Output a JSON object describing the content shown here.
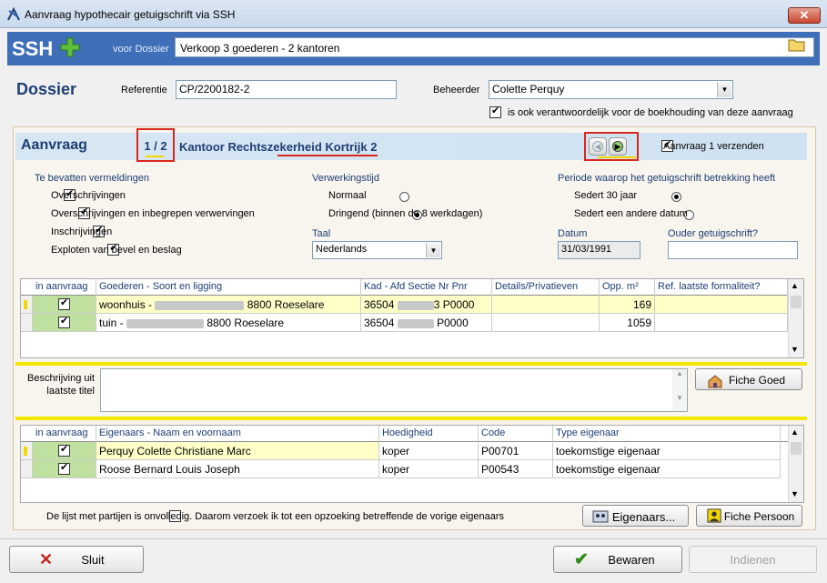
{
  "window": {
    "title": "Aanvraag hypothecair getuigschrift via SSH",
    "close_label": "✕"
  },
  "header": {
    "logo": "SSH",
    "voor_dossier_label": "voor Dossier",
    "dossier_value": "Verkoop  3 goederen - 2 kantoren"
  },
  "dossier": {
    "heading": "Dossier",
    "referentie_label": "Referentie",
    "referentie_value": "CP/2200182-2",
    "beheerder_label": "Beheerder",
    "beheerder_value": "Colette Perquy",
    "boekhouding_label": "is ook verantwoordelijk voor de boekhouding van deze aanvraag"
  },
  "aanvraag": {
    "heading": "Aanvraag",
    "counter": "1 / 2",
    "kantoor": "Kantoor Rechtszekerheid Kortrijk 2",
    "verzenden_label": "Aanvraag 1 verzenden"
  },
  "vermeldingen": {
    "title": "Te bevatten vermeldingen",
    "items": [
      {
        "label": "Overschrijvingen",
        "checked": true
      },
      {
        "label": "Overschrijvingen en inbegrepen verwervingen",
        "checked": true
      },
      {
        "label": "Inschrijvingen",
        "checked": true
      },
      {
        "label": "Exploten van bevel en beslag",
        "checked": true
      }
    ]
  },
  "verwerkingstijd": {
    "title": "Verwerkingstijd",
    "options": [
      {
        "label": "Normaal",
        "selected": false
      },
      {
        "label": "Dringend (binnen de 8 werkdagen)",
        "selected": true
      }
    ],
    "taal_label": "Taal",
    "taal_value": "Nederlands"
  },
  "periode": {
    "title": "Periode waarop het getuigschrift betrekking heeft",
    "options": [
      {
        "label": "Sedert 30 jaar",
        "selected": true
      },
      {
        "label": "Sedert een andere datum",
        "selected": false
      }
    ],
    "datum_label": "Datum",
    "datum_value": "31/03/1991",
    "ouder_label": "Ouder getuigschrift?"
  },
  "goederen": {
    "headers": [
      "in aanvraag",
      "Goederen - Soort en ligging",
      "Kad - Afd Sectie Nr Pnr",
      "Details/Privatieven",
      "Opp. m²",
      "Ref. laatste formaliteit?"
    ],
    "rows": [
      {
        "goed": "woonhuis  -",
        "postcode": "8800 Roeselare",
        "kad_a": "36504",
        "kad_b": "3 P0000",
        "opp": "169"
      },
      {
        "goed": "tuin  -",
        "postcode": "8800 Roeselare",
        "kad_a": "36504",
        "kad_b": "P0000",
        "opp": "1059"
      }
    ]
  },
  "beschrijving_label": "Beschrijving uit laatste titel",
  "fiche_goed_label": "Fiche Goed",
  "eigenaars": {
    "headers": [
      "in aanvraag",
      "Eigenaars - Naam en voornaam",
      "Hoedigheid",
      "Code",
      "Type eigenaar"
    ],
    "rows": [
      {
        "naam": "Perquy Colette Christiane Marc",
        "hoedigheid": "koper",
        "code": "P00701",
        "type": "toekomstige eigenaar"
      },
      {
        "naam": "Roose Bernard Louis Joseph",
        "hoedigheid": "koper",
        "code": "P00543",
        "type": "toekomstige eigenaar"
      }
    ]
  },
  "onvolledig_label": "De lijst met partijen is onvolledig. Daarom verzoek ik tot een opzoeking betreffende de vorige eigenaars",
  "eigenaars_btn": "Eigenaars...",
  "fiche_persoon_btn": "Fiche Persoon",
  "footer": {
    "sluit": "Sluit",
    "bewaren": "Bewaren",
    "indienen": "Indienen"
  },
  "colors": {
    "brand_blue": "#3f6fb8",
    "title_blue": "#1e3e73",
    "highlight_red": "#d8281c",
    "row_yellow": "#ffffc8",
    "green": "#c0e0a0"
  }
}
